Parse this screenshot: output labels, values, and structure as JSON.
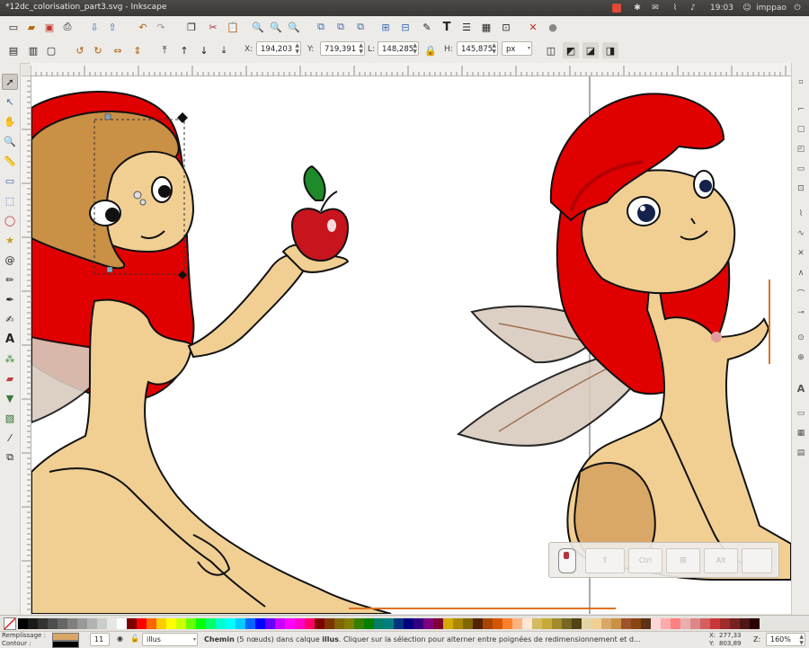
{
  "window": {
    "title": "*12dc_colorisation_part3.svg - Inkscape",
    "clock": "19:03",
    "user": "imppao"
  },
  "toolbar_controls": {
    "x_label": "X:",
    "x_value": "194,203",
    "y_label": "Y:",
    "y_value": "719,391",
    "w_label": "L:",
    "w_value": "148,285",
    "h_label": "H:",
    "h_value": "145,875",
    "unit": "px"
  },
  "dock_panel": {
    "btn1": "Ctrl",
    "btn2": "Alt"
  },
  "status": {
    "fill_label": "Remplissage :",
    "stroke_label": "Contour :",
    "stroke_width": "11",
    "layer": "illus",
    "message_bold": "Chemin",
    "message_rest": " (5 nœuds) dans calque ",
    "message_layer": "illus",
    "message_end": ". Cliquer sur la sélection pour alterner entre poignées de redimensionnement et d...",
    "x_label": "X:",
    "x_value": "277,33",
    "y_label": "Y:",
    "y_value": "803,89",
    "z_label": "Z:",
    "zoom": "160%"
  },
  "colors": {
    "hair": "#e00000",
    "hair_dark": "#b40000",
    "skin": "#f1cf93",
    "skin_shade": "#d9a766",
    "brown_hair": "#c99046",
    "wing": "#d9ccbf",
    "apple": "#c8141c",
    "leaf": "#1f8a2a",
    "outline": "#111111",
    "swatches": [
      "#000000",
      "#1a1a1a",
      "#333333",
      "#4d4d4d",
      "#666666",
      "#808080",
      "#999999",
      "#b3b3b3",
      "#cccccc",
      "#e6e6e6",
      "#ffffff",
      "#800000",
      "#ff0000",
      "#ff6600",
      "#ffcc00",
      "#ffff00",
      "#ccff00",
      "#66ff00",
      "#00ff00",
      "#00ff66",
      "#00ffcc",
      "#00ffff",
      "#00ccff",
      "#0066ff",
      "#0000ff",
      "#6600ff",
      "#cc00ff",
      "#ff00ff",
      "#ff00cc",
      "#ff0066",
      "#7f0000",
      "#7f3300",
      "#7f6600",
      "#7f7f00",
      "#337f00",
      "#007f00",
      "#007f66",
      "#007f7f",
      "#00337f",
      "#00007f",
      "#33007f",
      "#7f007f",
      "#7f0033",
      "#d4aa00",
      "#aa8800",
      "#806600",
      "#552200",
      "#aa4400",
      "#d45500",
      "#ff7f2a",
      "#ffb380",
      "#ffe6d5",
      "#d3bc5f",
      "#c8ab37",
      "#a08a2c",
      "#786721",
      "#504416",
      "#e5d5a5",
      "#f1cf93",
      "#d9a766",
      "#c99046",
      "#a0522d",
      "#8b4513",
      "#5c3317",
      "#ffd7d7",
      "#ffaaaa",
      "#ff8080",
      "#e9afaf",
      "#de8787",
      "#d35f5f",
      "#c83737",
      "#a02c2c",
      "#782121",
      "#501616",
      "#2b0000"
    ]
  }
}
